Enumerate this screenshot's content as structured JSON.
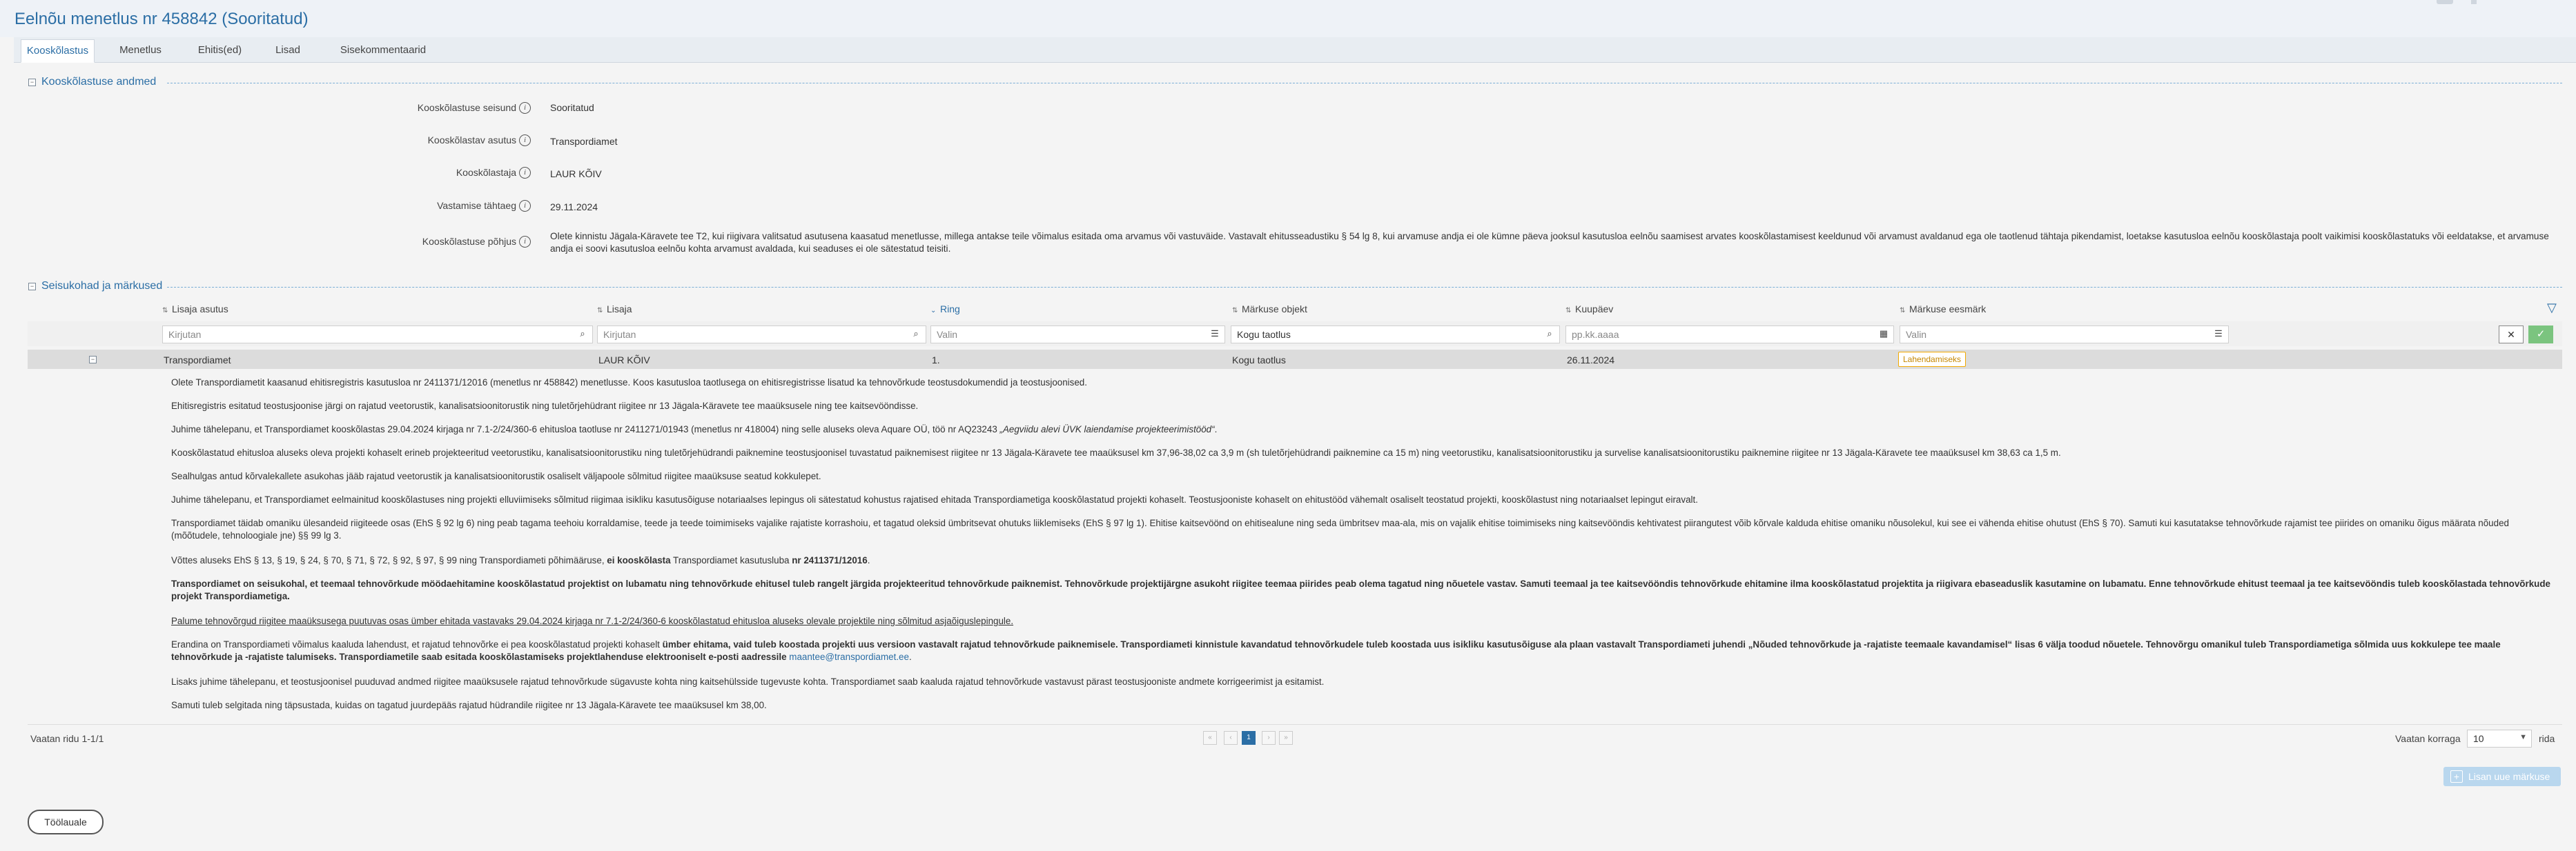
{
  "page": {
    "title": "Eelnõu menetlus nr 458842 (Sooritatud)"
  },
  "tabs": [
    {
      "label": "Kooskõlastus",
      "active": true
    },
    {
      "label": "Menetlus"
    },
    {
      "label": "Ehitis(ed)"
    },
    {
      "label": "Lisad"
    },
    {
      "label": "Sisekommentaarid"
    }
  ],
  "approval_section": {
    "heading": "Kooskõlastuse andmed",
    "toggle": "−",
    "rows": [
      {
        "label": "Kooskõlastuse seisund",
        "value": "Sooritatud"
      },
      {
        "label": "Kooskõlastav asutus",
        "value": "Transpordiamet"
      },
      {
        "label": "Kooskõlastaja",
        "value": "LAUR KÕIV"
      },
      {
        "label": "Vastamise tähtaeg",
        "value": "29.11.2024"
      },
      {
        "label": "Kooskõlastuse põhjus",
        "value": "Olete kinnistu Jägala-Käravete tee T2, kui riigivara valitsatud asutusena kaasatud menetlusse, millega antakse teile võimalus esitada oma arvamus või vastuväide. Vastavalt ehitusseadustiku § 54 lg 8, kui arvamuse andja ei ole kümne päeva jooksul kasutusloa eelnõu saamisest arvates kooskõlastamisest keeldunud või arvamust avaldanud ega ole taotlenud tähtaja pikendamist, loetakse kasutusloa eelnõu kooskõlastaja poolt vaikimisi kooskõlastatuks või eeldatakse, et arvamuse andja ei soovi kasutusloa eelnõu kohta arvamust avaldada, kui seaduses ei ole sätestatud teisiti."
      }
    ]
  },
  "remarks_section": {
    "heading": "Seisukohad ja märkused",
    "toggle": "−",
    "columns": [
      {
        "label": "Lisaja asutus",
        "sorted": false
      },
      {
        "label": "Lisaja",
        "sorted": false
      },
      {
        "label": "Ring",
        "sorted": true
      },
      {
        "label": "Märkuse objekt",
        "sorted": false
      },
      {
        "label": "Kuupäev",
        "sorted": false
      },
      {
        "label": "Märkuse eesmärk",
        "sorted": false
      }
    ],
    "filters": {
      "org_placeholder": "Kirjutan",
      "adder_placeholder": "Kirjutan",
      "round_placeholder": "Valin",
      "object_value": "Kogu taotlus",
      "date_placeholder": "pp.kk.aaaa",
      "purpose_placeholder": "Valin",
      "clear_icon": "✕",
      "apply_icon": "✓"
    },
    "row": {
      "toggle": "−",
      "org": "Transpordiamet",
      "adder": "LAUR KÕIV",
      "round": "1.",
      "object": "Kogu taotlus",
      "date": "26.11.2024",
      "purpose": "Lahendamiseks",
      "purpose_color": "#f2a900"
    },
    "paragraphs": {
      "p1": "Olete Transpordiametit kaasanud ehitisregistris kasutusloa nr 2411371/12016 (menetlus nr 458842) menetlusse. Koos kasutusloa taotlusega on ehitisregistrisse lisatud ka tehnovõrkude teostusdokumendid ja teostusjoonised.",
      "p2": "Ehitisregistris esitatud teostusjoonise järgi on rajatud veetorustik, kanalisatsioonitorustik ning tuletõrjehüdrant riigitee nr 13 Jägala-Käravete tee maaüksusele ning tee kaitsevööndisse.",
      "p3a": "Juhime tähelepanu, et Transpordiamet kooskõlastas 29.04.2024 kirjaga nr 7.1-2/24/360-6 ehitusloa taotluse nr 2411271/01943 (menetlus nr 418004) ning selle aluseks oleva Aquare OÜ, töö nr AQ23243 ",
      "p3b": "„Aegviidu alevi ÜVK laiendamise projekteerimistööd“",
      "p3c": ".",
      "p4": "Kooskõlastatud ehitusloa aluseks oleva projekti kohaselt erineb projekteeritud veetorustiku, kanalisatsioonitorustiku ning tuletõrjehüdrandi paiknemine teostusjoonisel tuvastatud paiknemisest riigitee nr 13 Jägala-Käravete tee maaüksusel km 37,96-38,02 ca 3,9 m (sh tuletõrjehüdrandi paiknemine ca 15 m) ning veetorustiku, kanalisatsioonitorustiku ja survelise kanalisatsioonitorustiku paiknemine riigitee nr 13 Jägala-Käravete tee maaüksusel km 38,63 ca 1,5 m.",
      "p5": "Sealhulgas antud kõrvalekallete asukohas jääb rajatud veetorustik ja kanalisatsioonitorustik osaliselt väljapoole sõlmitud riigitee maaüksuse seatud kokkulepet.",
      "p6": "Juhime tähelepanu, et Transpordiamet eelmainitud kooskõlastuses ning projekti elluviimiseks sõlmitud riigimaa isikliku kasutusõiguse notariaalses lepingus oli sätestatud kohustus rajatised ehitada Transpordiametiga kooskõlastatud projekti kohaselt. Teostusjooniste kohaselt on ehitustööd vähemalt osaliselt teostatud projekti, kooskõlastust ning notariaalset lepingut eiravalt.",
      "p7": "Transpordiamet täidab omaniku ülesandeid riigiteede osas (EhS § 92 lg 6) ning peab tagama teehoiu korraldamise, teede ja teede toimimiseks vajalike rajatiste korrashoiu, et tagatud oleksid ümbritsevat ohutuks liiklemiseks (EhS § 97 lg 1). Ehitise kaitsevöönd on ehitisealune ning seda ümbritsev maa-ala, mis on vajalik ehitise toimimiseks ning kaitsevööndis kehtivatest piirangutest võib kõrvale kalduda ehitise omaniku nõusolekul, kui see ei vähenda ehitise ohutust (EhS § 70). Samuti kui kasutatakse tehnovõrkude rajamist tee piirides on omaniku õigus määrata nõuded (mõõtudele, tehnoloogiale jne) §§ 99 lg 3.",
      "p8a": "Võttes aluseks EhS § 13, § 19, § 24, § 70, § 71, § 72, § 92, § 97, § 99 ning Transpordiameti põhimääruse, ",
      "p8b": "ei kooskõlasta",
      "p8c": " Transpordiamet kasutusluba ",
      "p8d": "nr 2411371/12016",
      "p8e": ".",
      "p9": "Transpordiamet on seisukohal, et teemaal tehnovõrkude mööda­ehitamine kooskõlastatud projektist on lubamatu ning tehnovõrkude ehitusel tuleb rangelt järgida projekteeritud tehnovõrkude paiknemist. Tehnovõrkude projektijärgne asukoht riigitee teemaa piirides peab olema tagatud ning nõuetele vastav. Samuti teemaal ja tee kaitsevööndis tehnovõrkude ehitamine ilma kooskõlastatud projektita ja riigivara ebaseaduslik kasutamine on lubamatu. Enne tehnovõrkude ehitust teemaal ja tee kaitsevööndis tuleb kooskõlastada tehnovõrkude projekt Transpordiametiga.",
      "p10": "Palume tehnovõrgud riigitee maaüksusega puutuvas osas ümber ehitada vastavaks 29.04.2024 kirjaga nr 7.1-2/24/360-6 kooskõlastatud ehitusloa aluseks olevale projektile ning sõlmitud asjaõiguslepingule.",
      "p11a": "Erandina on Transpordiameti võimalus kaaluda lahendust, et rajatud tehnovõrke ei pea kooskõlastatud projekti kohaselt ",
      "p11b": "ümber ehitama, vaid tuleb koostada projekti uus versioon vastavalt rajatud tehnovõrkude paiknemisele. Transpordiameti kinnistule kavandatud tehnovõrkudele tuleb koostada uus isikliku kasutusõiguse ala plaan vastavalt Transpordiameti juhendi „Nõuded tehnovõrkude ja -rajatiste teemaale kavandamisel“ lisas 6 välja toodud nõuetele. Tehnovõrgu omanikul tuleb Transpordiametiga sõlmida uus kokkulepe tee maale tehnovõrkude ja -rajatiste talumiseks. Transpordiametile saab esitada kooskõlastamiseks projektlahenduse elektrooniselt e-posti aadressile ",
      "p11c": "maantee@transpordiamet.ee",
      "p11d": ".",
      "p12": "Lisaks juhime tähelepanu, et teostusjoonisel puuduvad andmed riigitee maaüksusele rajatud tehnovõrkude sügavuste kohta ning kaitsehülsside tugevuste kohta. Transpordiamet saab kaaluda rajatud tehnovõrkude vastavust pärast teostusjooniste andmete korrigeerimist ja esitamist.",
      "p13": "Samuti tuleb selgitada ning täpsustada, kuidas on tagatud juurdepääs rajatud hüdrandile riigitee nr 13 Jägala-Käravete tee maaüksusel km 38,00."
    },
    "footer": {
      "rows_info": "Vaatan ridu 1-1/1",
      "pagination": {
        "first": "«",
        "prev": "‹",
        "current": "1",
        "next": "›",
        "last": "»"
      },
      "per_page_label": "Vaatan korraga",
      "per_page_value": "10",
      "rows_suffix": "rida",
      "add_button": "Lisan uue märkuse",
      "add_button_icon": "+"
    }
  },
  "back_button": "Töölauale"
}
